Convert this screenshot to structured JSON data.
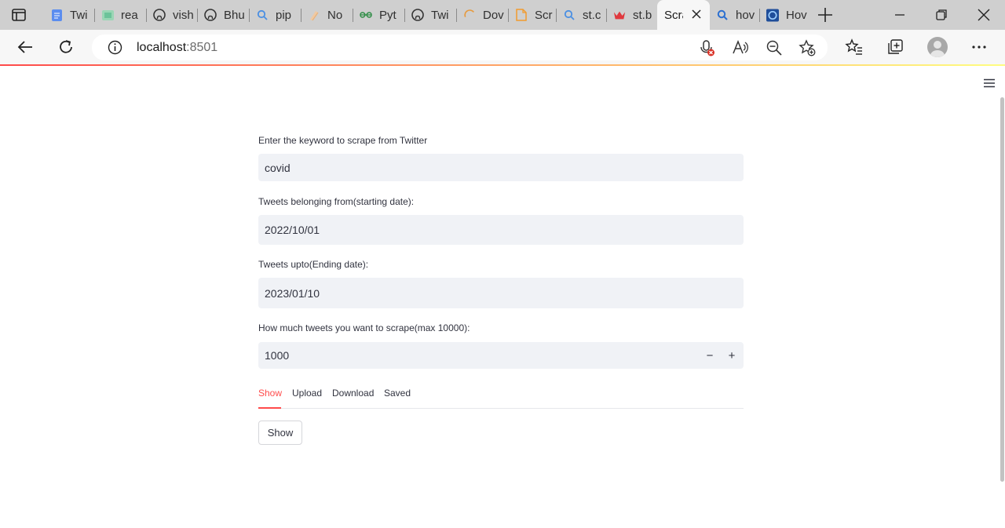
{
  "browser": {
    "tabs": [
      {
        "title": "Twi",
        "icon": "docs-icon",
        "color": "#5b8def"
      },
      {
        "title": "rea",
        "icon": "sheet-icon",
        "color": "#6cc39a"
      },
      {
        "title": "vish",
        "icon": "github-icon",
        "color": "#333333"
      },
      {
        "title": "Bhu",
        "icon": "github-icon",
        "color": "#333333"
      },
      {
        "title": "pip",
        "icon": "search-icon",
        "color": "#4a8fe3"
      },
      {
        "title": "No",
        "icon": "notes-icon",
        "color": "#e8b27a"
      },
      {
        "title": "Pyt",
        "icon": "gfg-icon",
        "color": "#2f8d46"
      },
      {
        "title": "Twi",
        "icon": "github-icon",
        "color": "#333333"
      },
      {
        "title": "Dov",
        "icon": "loading-icon",
        "color": "#e79a3c"
      },
      {
        "title": "Scr",
        "icon": "file-icon",
        "color": "#f29b2e"
      },
      {
        "title": "st.c",
        "icon": "search-icon",
        "color": "#4a8fe3"
      },
      {
        "title": "st.b",
        "icon": "crown-icon",
        "color": "#e0393e"
      },
      {
        "title": "Scra",
        "icon": "",
        "color": ""
      },
      {
        "title": "hov",
        "icon": "search-icon",
        "color": "#2a6fd1"
      },
      {
        "title": "Hov",
        "icon": "edge-icon",
        "color": "#1f4e9a"
      }
    ],
    "url_host": "localhost",
    "url_port": ":8501"
  },
  "form": {
    "keyword_label": "Enter the keyword to scrape from Twitter",
    "keyword_value": "covid",
    "start_label": "Tweets belonging from(starting date):",
    "start_value": "2022/10/01",
    "end_label": "Tweets upto(Ending date):",
    "end_value": "2023/01/10",
    "count_label": "How much tweets you want to scrape(max 10000):",
    "count_value": "1000",
    "minus": "−",
    "plus": "+"
  },
  "tabs": [
    "Show",
    "Upload",
    "Download",
    "Saved"
  ],
  "show_button": "Show",
  "colors": {
    "accent": "#ff4b4b",
    "input_bg": "#f0f2f6"
  }
}
